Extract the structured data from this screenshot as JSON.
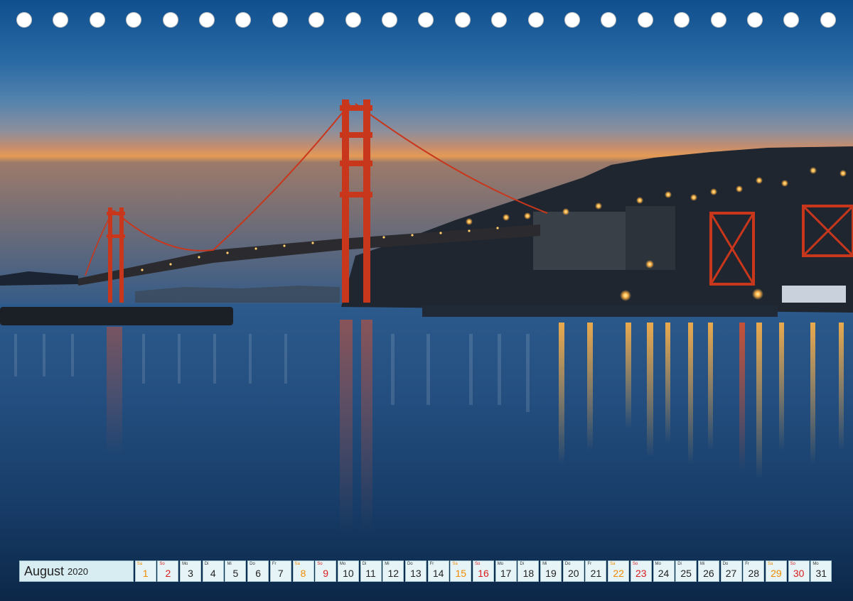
{
  "calendar": {
    "month": "August",
    "year": "2020",
    "days": [
      {
        "dow": "Sa",
        "num": "1",
        "type": "sat"
      },
      {
        "dow": "So",
        "num": "2",
        "type": "sun"
      },
      {
        "dow": "Mo",
        "num": "3",
        "type": "weekday"
      },
      {
        "dow": "Di",
        "num": "4",
        "type": "weekday"
      },
      {
        "dow": "Mi",
        "num": "5",
        "type": "weekday"
      },
      {
        "dow": "Do",
        "num": "6",
        "type": "weekday"
      },
      {
        "dow": "Fr",
        "num": "7",
        "type": "weekday"
      },
      {
        "dow": "Sa",
        "num": "8",
        "type": "sat"
      },
      {
        "dow": "So",
        "num": "9",
        "type": "sun"
      },
      {
        "dow": "Mo",
        "num": "10",
        "type": "weekday"
      },
      {
        "dow": "Di",
        "num": "11",
        "type": "weekday"
      },
      {
        "dow": "Mi",
        "num": "12",
        "type": "weekday"
      },
      {
        "dow": "Do",
        "num": "13",
        "type": "weekday"
      },
      {
        "dow": "Fr",
        "num": "14",
        "type": "weekday"
      },
      {
        "dow": "Sa",
        "num": "15",
        "type": "sat"
      },
      {
        "dow": "So",
        "num": "16",
        "type": "sun"
      },
      {
        "dow": "Mo",
        "num": "17",
        "type": "weekday"
      },
      {
        "dow": "Di",
        "num": "18",
        "type": "weekday"
      },
      {
        "dow": "Mi",
        "num": "19",
        "type": "weekday"
      },
      {
        "dow": "Do",
        "num": "20",
        "type": "weekday"
      },
      {
        "dow": "Fr",
        "num": "21",
        "type": "weekday"
      },
      {
        "dow": "Sa",
        "num": "22",
        "type": "sat"
      },
      {
        "dow": "So",
        "num": "23",
        "type": "sun"
      },
      {
        "dow": "Mo",
        "num": "24",
        "type": "weekday"
      },
      {
        "dow": "Di",
        "num": "25",
        "type": "weekday"
      },
      {
        "dow": "Mi",
        "num": "26",
        "type": "weekday"
      },
      {
        "dow": "Do",
        "num": "27",
        "type": "weekday"
      },
      {
        "dow": "Fr",
        "num": "28",
        "type": "weekday"
      },
      {
        "dow": "Sa",
        "num": "29",
        "type": "sat"
      },
      {
        "dow": "So",
        "num": "30",
        "type": "sun"
      },
      {
        "dow": "Mo",
        "num": "31",
        "type": "weekday"
      }
    ]
  },
  "colors": {
    "saturday": "#f08a00",
    "sunday": "#d81d1d",
    "weekday": "#222222",
    "cell_background": "#e6f4f7",
    "bridge": "#c8361c",
    "light_glow": "#ffb347"
  },
  "binding_holes": 23
}
